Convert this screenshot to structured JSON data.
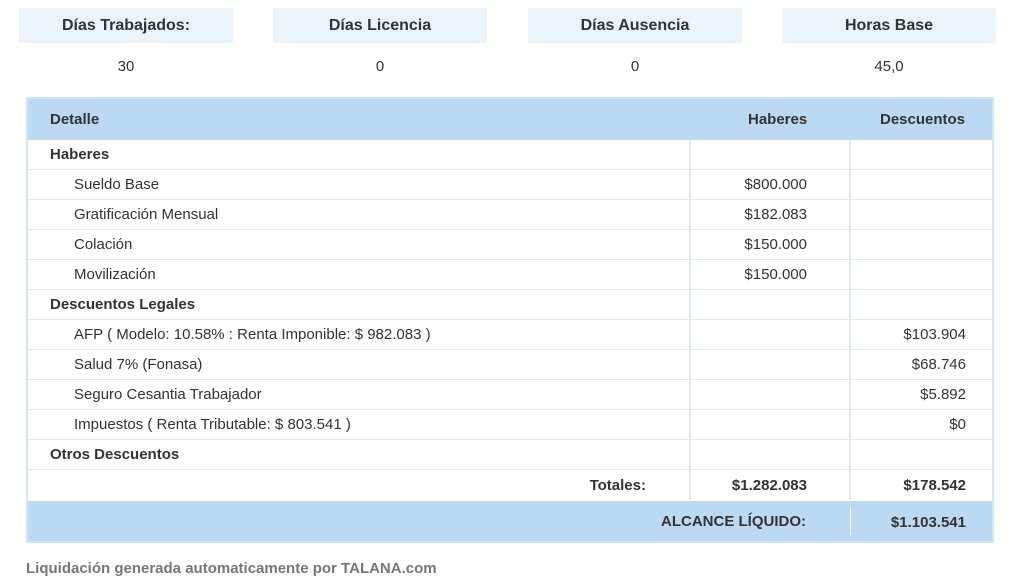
{
  "summary": [
    {
      "label": "Días Trabajados:",
      "value": "30"
    },
    {
      "label": "Días Licencia",
      "value": "0"
    },
    {
      "label": "Días Ausencia",
      "value": "0"
    },
    {
      "label": "Horas Base",
      "value": "45,0"
    }
  ],
  "table": {
    "headers": {
      "detalle": "Detalle",
      "haberes": "Haberes",
      "descuentos": "Descuentos"
    },
    "sections": {
      "haberes": {
        "title": "Haberes",
        "items": [
          {
            "label": "Sueldo Base",
            "haber": "$800.000",
            "descuento": ""
          },
          {
            "label": "Gratificación Mensual",
            "haber": "$182.083",
            "descuento": ""
          },
          {
            "label": "Colación",
            "haber": "$150.000",
            "descuento": ""
          },
          {
            "label": "Movilización",
            "haber": "$150.000",
            "descuento": ""
          }
        ]
      },
      "legales": {
        "title": "Descuentos Legales",
        "items": [
          {
            "label": "AFP ( Modelo: 10.58% : Renta Imponible: $ 982.083 )",
            "haber": "",
            "descuento": "$103.904"
          },
          {
            "label": "Salud 7% (Fonasa)",
            "haber": "",
            "descuento": "$68.746"
          },
          {
            "label": "Seguro Cesantia Trabajador",
            "haber": "",
            "descuento": "$5.892"
          },
          {
            "label": "Impuestos ( Renta Tributable: $ 803.541 )",
            "haber": "",
            "descuento": "$0"
          }
        ]
      },
      "otros": {
        "title": "Otros Descuentos"
      }
    },
    "totals": {
      "label": "Totales:",
      "haberes": "$1.282.083",
      "descuentos": "$178.542"
    },
    "liquido": {
      "label": "ALCANCE LÍQUIDO:",
      "value": "$1.103.541"
    }
  },
  "footer": "Liquidación generada automaticamente por TALANA.com"
}
